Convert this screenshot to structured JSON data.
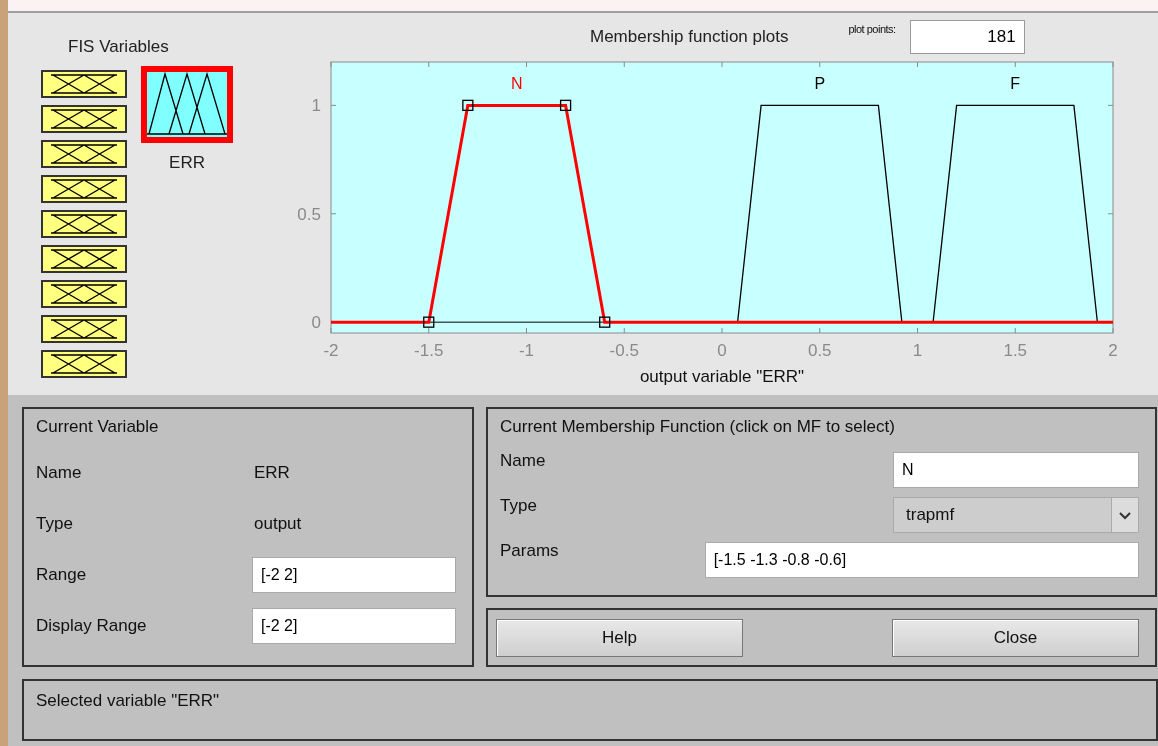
{
  "fis_variables": {
    "title": "FIS Variables",
    "inputs": [
      {
        "selected": false
      },
      {
        "selected": false
      },
      {
        "selected": false
      },
      {
        "selected": false
      },
      {
        "selected": false
      },
      {
        "selected": false
      },
      {
        "selected": false
      },
      {
        "selected": false
      },
      {
        "selected": false
      }
    ],
    "outputs": [
      {
        "label": "ERR",
        "selected": true
      }
    ]
  },
  "plot": {
    "title": "Membership function plots",
    "curves": [
      {
        "selected": true
      },
      {
        "selected": false
      },
      {
        "selected": false
      }
    ],
    "plot_points_label": "plot points:",
    "plot_points": "181",
    "chart_data": {
      "type": "line",
      "xlabel": "output variable \"ERR\"",
      "x": [
        -2,
        -1.5,
        -1.3,
        -0.8,
        -0.6,
        0.08,
        0.2,
        0.8,
        0.92,
        1.08,
        1.2,
        1.8,
        1.92,
        2
      ],
      "series": [
        {
          "name": "N",
          "color": "#ff0000",
          "values": [
            0,
            0,
            1,
            1,
            0,
            0,
            0,
            0,
            0,
            0,
            0,
            0,
            0,
            0
          ]
        },
        {
          "name": "P",
          "color": "#000000",
          "values": [
            null,
            null,
            null,
            null,
            null,
            0,
            1,
            1,
            0,
            null,
            null,
            null,
            null,
            null
          ]
        },
        {
          "name": "F",
          "color": "#000000",
          "values": [
            null,
            null,
            null,
            null,
            null,
            null,
            null,
            null,
            null,
            0,
            1,
            1,
            0,
            null
          ]
        }
      ],
      "xlim": [
        -2,
        2
      ],
      "ylim": [
        -0.05,
        1.2
      ],
      "xticks": [
        -2,
        -1.5,
        -1,
        -0.5,
        0,
        0.5,
        1,
        1.5,
        2
      ],
      "yticks": [
        0,
        0.5,
        1
      ]
    }
  },
  "current_variable": {
    "title": "Current Variable",
    "name_label": "Name",
    "name": "ERR",
    "type_label": "Type",
    "type": "output",
    "range_label": "Range",
    "range": "[-2 2]",
    "display_range_label": "Display Range",
    "display_range": "[-2 2]"
  },
  "current_mf": {
    "title": "Current Membership Function (click on MF to select)",
    "name_label": "Name",
    "name": "N",
    "type_label": "Type",
    "type": "trapmf",
    "params_label": "Params",
    "params": "[-1.5 -1.3 -0.8 -0.6]"
  },
  "buttons": [
    {
      "label": "Help"
    },
    {
      "label": "Close"
    }
  ],
  "status_bar": {
    "text": "Selected variable \"ERR\""
  }
}
